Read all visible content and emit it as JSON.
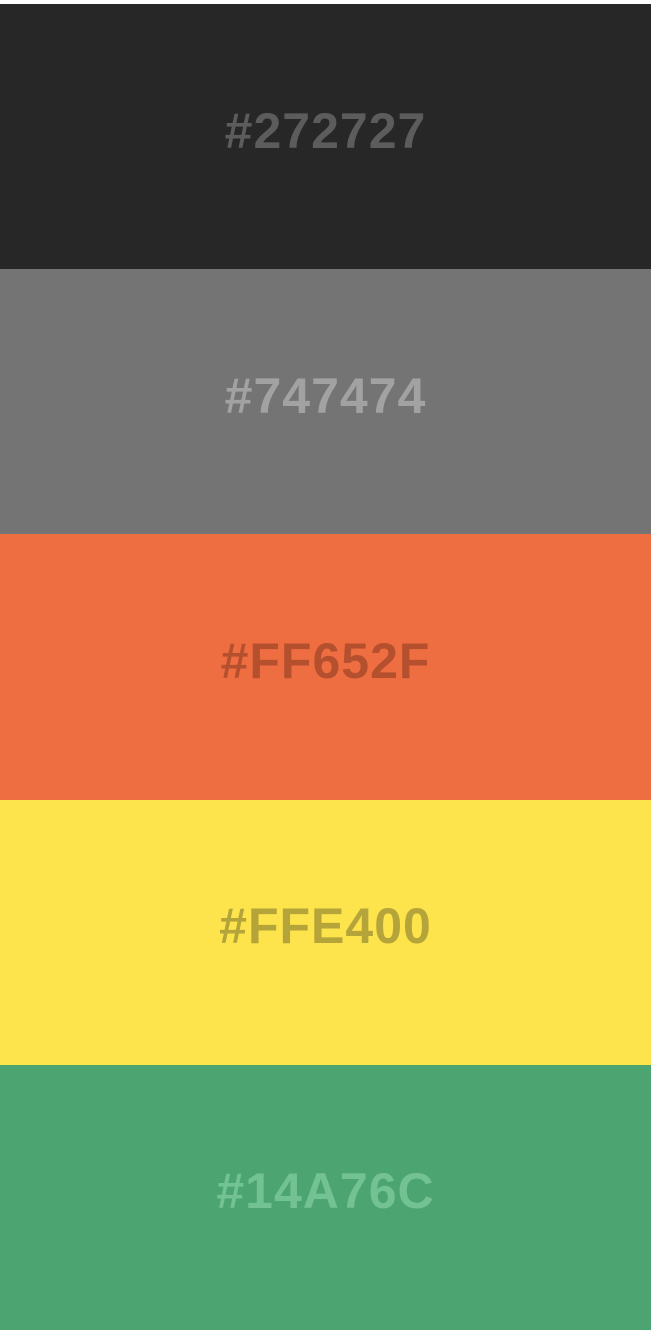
{
  "swatches": [
    {
      "label": "#272727",
      "background": "#272727",
      "text_color": "#5c5c5c"
    },
    {
      "label": "#747474",
      "background": "#747474",
      "text_color": "#a2a2a2"
    },
    {
      "label": "#FF652F",
      "background": "#ef6e41",
      "text_color": "#b4502e"
    },
    {
      "label": "#FFE400",
      "background": "#fde34c",
      "text_color": "#b4a43a"
    },
    {
      "label": "#14A76C",
      "background": "#4ca470",
      "text_color": "#72c294"
    }
  ]
}
